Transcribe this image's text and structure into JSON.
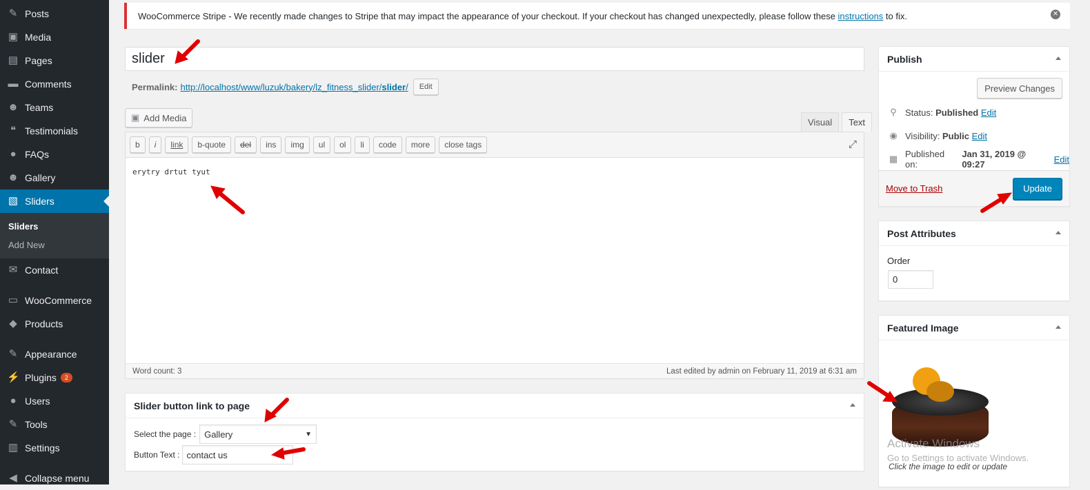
{
  "sidebar": {
    "items": [
      {
        "label": "Posts",
        "icon": "pin-icon"
      },
      {
        "label": "Media",
        "icon": "media-icon"
      },
      {
        "label": "Pages",
        "icon": "pages-icon"
      },
      {
        "label": "Comments",
        "icon": "comment-icon"
      },
      {
        "label": "Teams",
        "icon": "groups-icon"
      },
      {
        "label": "Testimonials",
        "icon": "testimonial-icon"
      },
      {
        "label": "FAQs",
        "icon": "faq-icon"
      },
      {
        "label": "Gallery",
        "icon": "gallery-icon"
      },
      {
        "label": "Sliders",
        "icon": "slides-icon"
      }
    ],
    "sub": [
      "Sliders",
      "Add New"
    ],
    "items2": [
      {
        "label": "Contact",
        "icon": "mail-icon"
      },
      {
        "label": "WooCommerce",
        "icon": "woo-icon"
      },
      {
        "label": "Products",
        "icon": "products-icon"
      },
      {
        "label": "Appearance",
        "icon": "brush-icon"
      },
      {
        "label": "Plugins",
        "icon": "plugin-icon",
        "badge": "2"
      },
      {
        "label": "Users",
        "icon": "user-icon"
      },
      {
        "label": "Tools",
        "icon": "wrench-icon"
      },
      {
        "label": "Settings",
        "icon": "settings-icon"
      },
      {
        "label": "Collapse menu",
        "icon": "collapse-icon"
      }
    ]
  },
  "notice": {
    "text": "WooCommerce Stripe - We recently made changes to Stripe that may impact the appearance of your checkout. If your checkout has changed unexpectedly, please follow these ",
    "link": "instructions",
    "after": " to fix."
  },
  "post": {
    "title": "slider",
    "permalink_label": "Permalink:",
    "permalink_base": "http://localhost/www/luzuk/bakery/lz_fitness_slider/",
    "permalink_slug": "slider",
    "permalink_end": "/",
    "edit": "Edit"
  },
  "editor": {
    "add_media": "Add Media",
    "tabs": [
      "Visual",
      "Text"
    ],
    "quicktags": [
      "b",
      "i",
      "link",
      "b-quote",
      "del",
      "ins",
      "img",
      "ul",
      "ol",
      "li",
      "code",
      "more",
      "close tags"
    ],
    "content": "erytry drtut tyut",
    "word_count": "Word count: 3",
    "last_edited": "Last edited by admin on February 11, 2019 at 6:31 am"
  },
  "slider_box": {
    "title": "Slider button link to page",
    "select_label": "Select the page :",
    "select_value": "Gallery",
    "button_label": "Button Text :",
    "button_value": "contact us"
  },
  "publish": {
    "title": "Publish",
    "preview": "Preview Changes",
    "status_label": "Status:",
    "status": "Published",
    "visibility_label": "Visibility:",
    "visibility": "Public",
    "published_label": "Published on:",
    "published": "Jan 31, 2019 @ 09:27",
    "edit": "Edit",
    "trash": "Move to Trash",
    "update": "Update"
  },
  "attributes": {
    "title": "Post Attributes",
    "order_label": "Order",
    "order": "0"
  },
  "featured": {
    "title": "Featured Image",
    "hint": "Click the image to edit or update"
  },
  "watermark": {
    "title": "Activate Windows",
    "sub": "Go to Settings to activate Windows."
  },
  "colors": {
    "accent": "#0073aa",
    "sidebar": "#23282d",
    "notice": "#dc3232",
    "arrow": "#e00000"
  }
}
